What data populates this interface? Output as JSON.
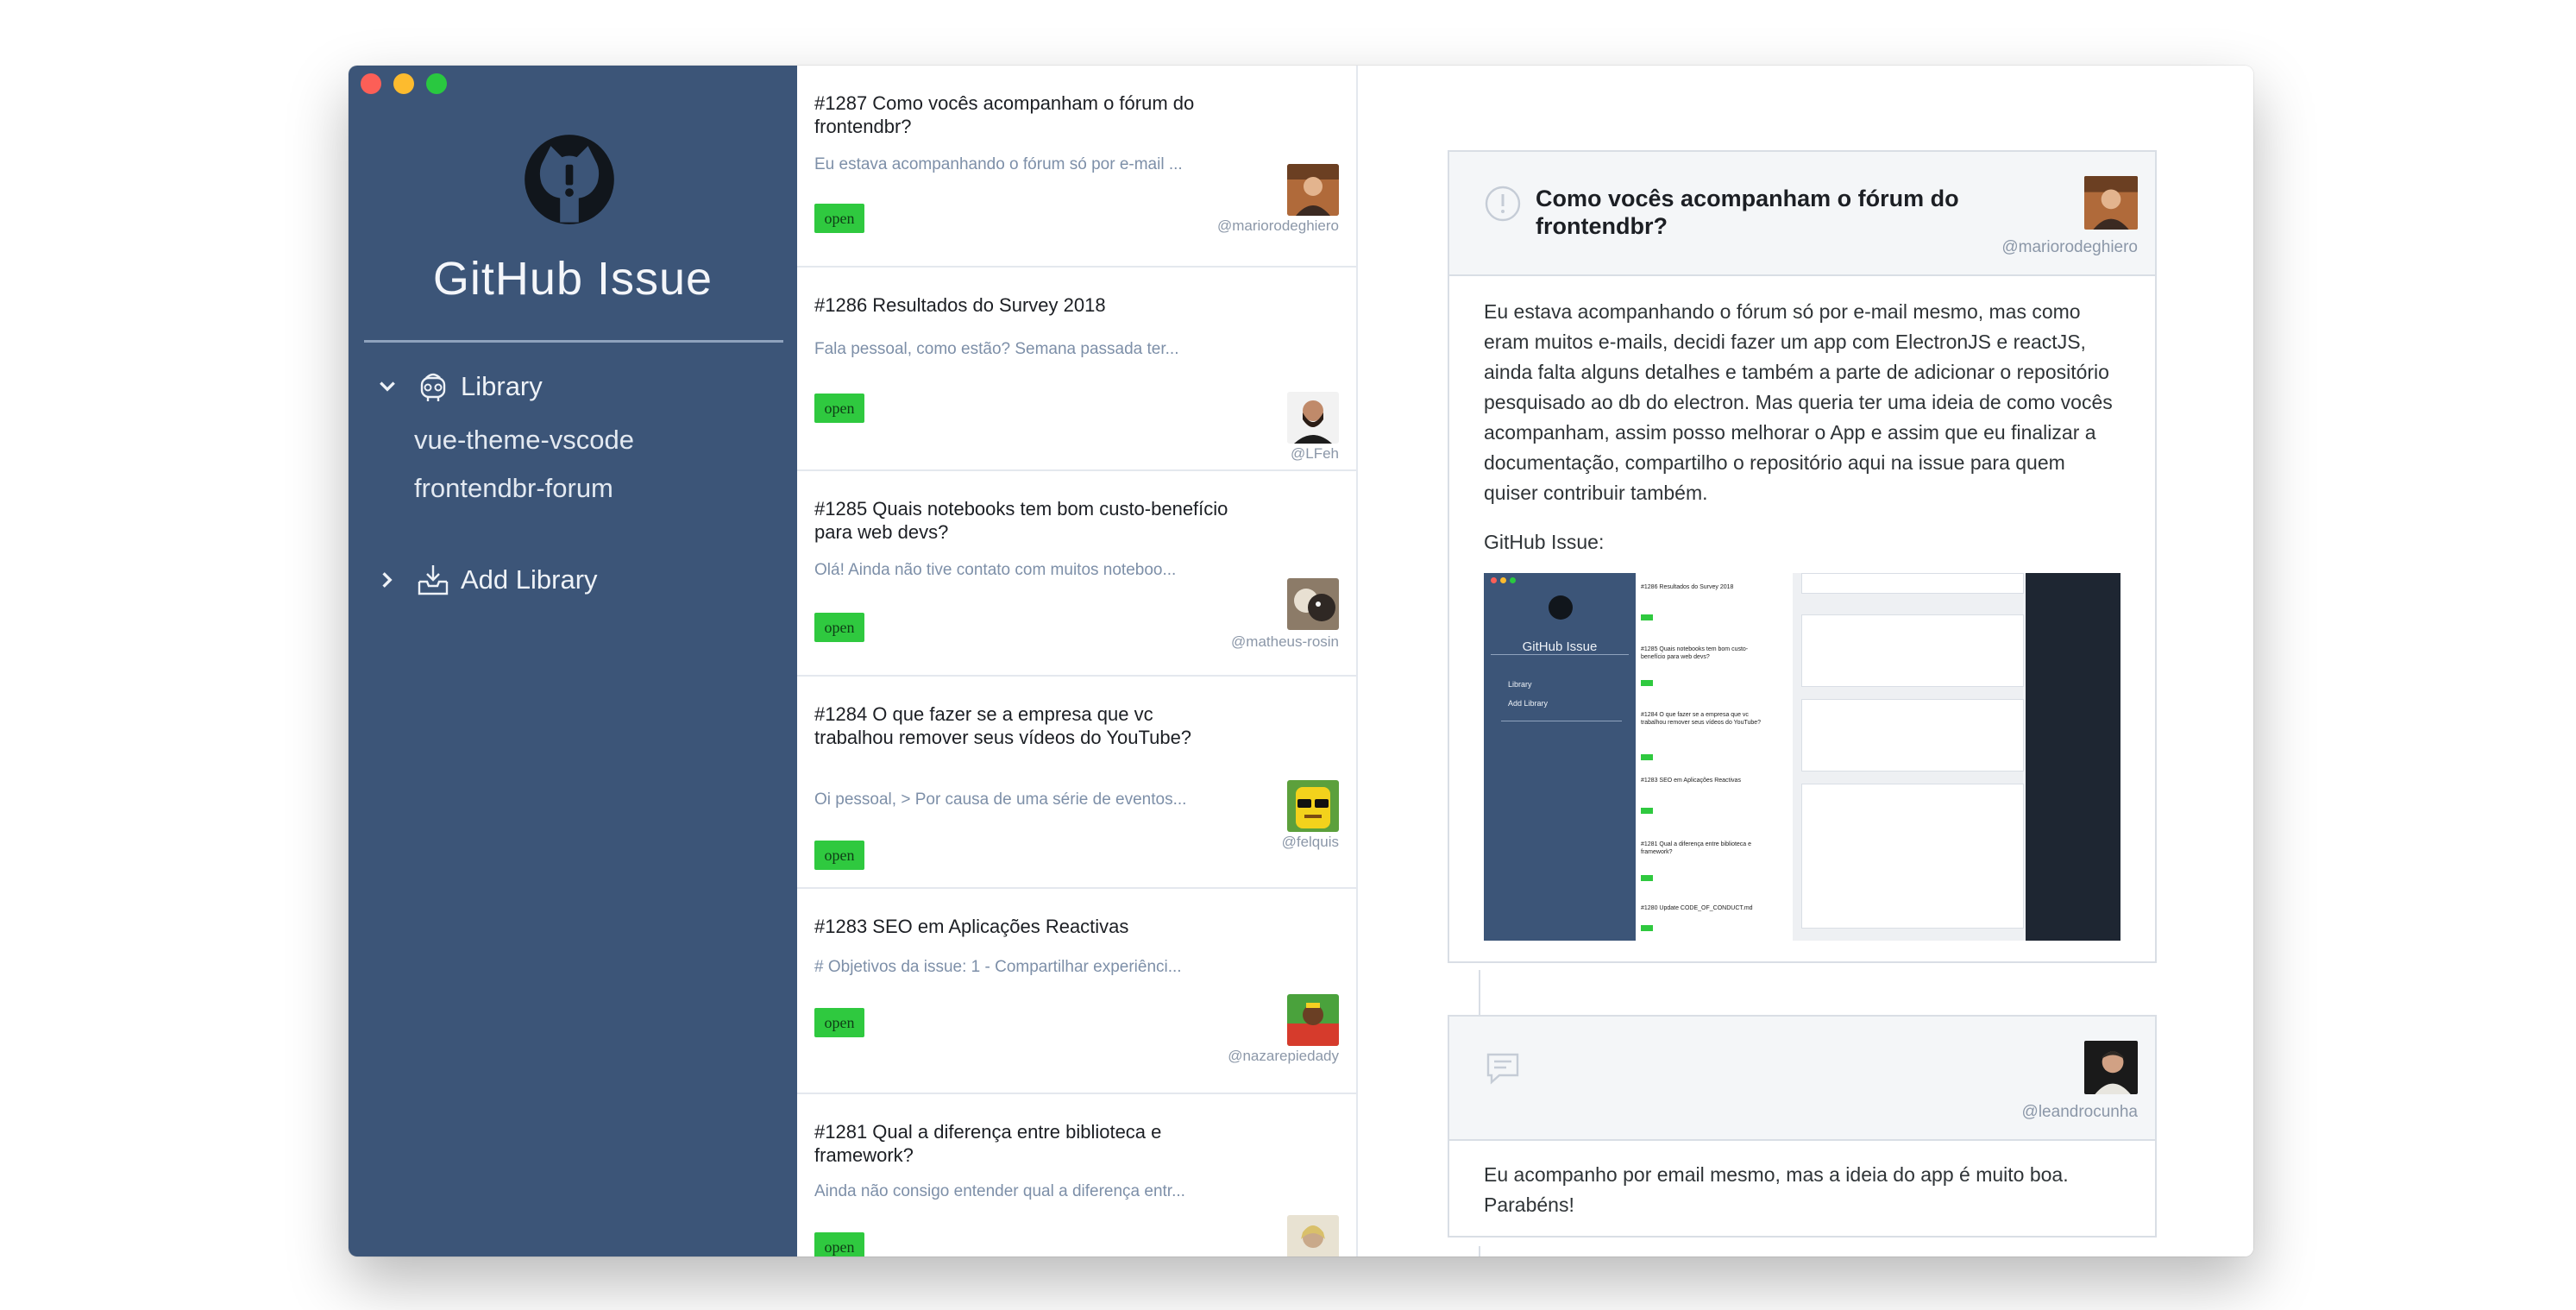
{
  "app": {
    "title": "GitHub Issue"
  },
  "sidebar": {
    "library": {
      "label": "Library",
      "items": [
        "vue-theme-vscode",
        "frontendbr-forum"
      ]
    },
    "add_library": {
      "label": "Add Library"
    }
  },
  "issues": [
    {
      "title": "#1287 Como vocês acompanham o fórum do frontendbr?",
      "preview": "Eu estava acompanhando o fórum só por e-mail ...",
      "status": "open",
      "author": "@mariorodeghiero"
    },
    {
      "title": "#1286 Resultados do Survey 2018",
      "preview": "Fala pessoal, como estão?  Semana passada ter...",
      "status": "open",
      "author": "@LFeh"
    },
    {
      "title": "#1285 Quais notebooks tem bom custo-benefício para web devs?",
      "preview": "Olá!  Ainda não tive contato com muitos noteboo...",
      "status": "open",
      "author": "@matheus-rosin"
    },
    {
      "title": "#1284 O que fazer se a empresa que vc trabalhou remover seus vídeos do YouTube?",
      "preview": "Oi pessoal,  > Por causa de uma série de eventos...",
      "status": "open",
      "author": "@felquis"
    },
    {
      "title": "#1283 SEO em Aplicações Reactivas",
      "preview": "# Objetivos da issue: 1 - Compartilhar experiênci...",
      "status": "open",
      "author": "@nazarepiedady"
    },
    {
      "title": "#1281 Qual a diferença entre biblioteca e framework?",
      "preview": "Ainda não consigo entender qual a diferença entr...",
      "status": "open",
      "author": ""
    }
  ],
  "detail": {
    "issue": {
      "title": "Como vocês acompanham o fórum do frontendbr?",
      "author": "@mariorodeghiero",
      "body": "Eu estava acompanhando o fórum só por e-mail mesmo, mas como eram muitos e-mails, decidi fazer um app com ElectronJS e reactJS, ainda falta alguns detalhes e também a parte de adicionar o repositório pesquisado ao db do electron. Mas queria ter uma ideia de como vocês acompanham, assim posso melhorar o App e assim que eu finalizar a documentação, compartilho o repositório aqui na issue para quem quiser contribuir também.",
      "caption": "GitHub Issue:"
    },
    "comment": {
      "author": "@leandrocunha",
      "body": "Eu acompanho por email mesmo, mas a ideia do app é muito boa. Parabéns!"
    }
  },
  "screenshot_thumb": {
    "app_title": "GitHub Issue",
    "library": "Library",
    "add_library": "Add Library",
    "issues": [
      "#1286 Resultados do Survey 2018",
      "#1285 Quais notebooks tem bom custo-benefício para web devs?",
      "#1284 O que fazer se a empresa que vc trabalhou remover seus vídeos do YouTube?",
      "#1283 SEO em Aplicações Reactivas",
      "#1281 Qual a diferença entre biblioteca e framework?",
      "#1280 Update CODE_OF_CONDUCT.md"
    ]
  },
  "colors": {
    "sidebar": "#3c5578",
    "badge": "#2fc93f",
    "preview_text": "#7d8fa8"
  }
}
